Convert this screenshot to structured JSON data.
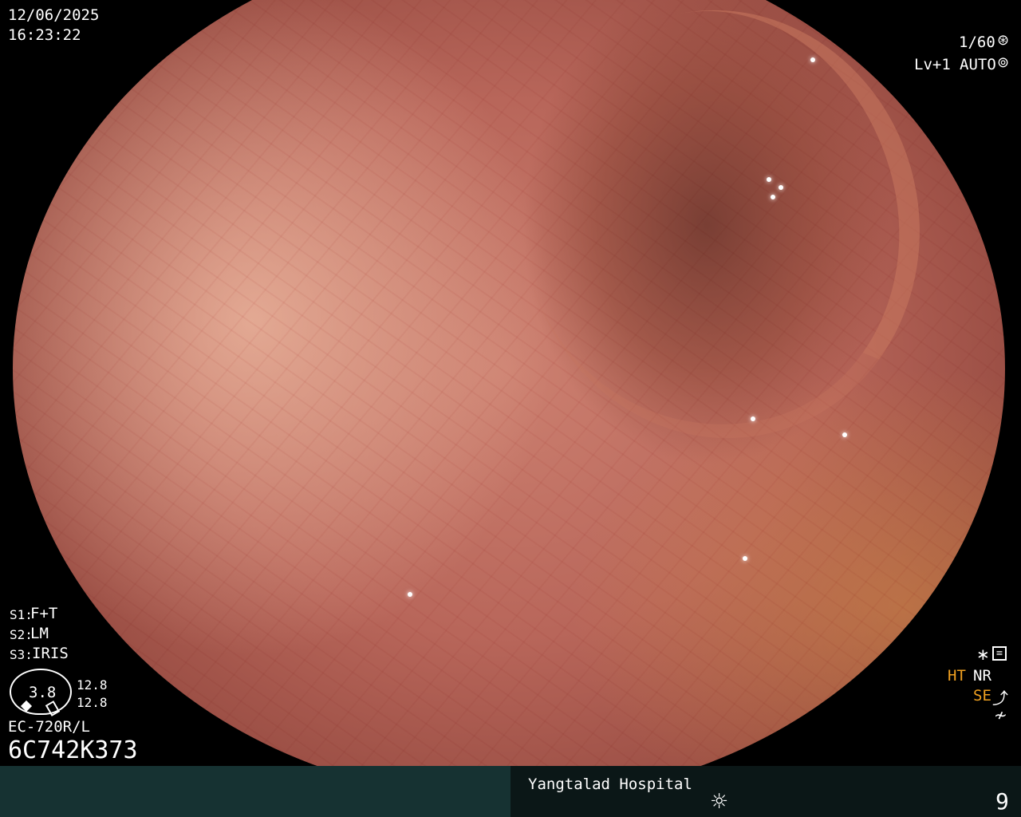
{
  "datetime": {
    "date": "12/06/2025",
    "time": "16:23:22"
  },
  "exposure": {
    "shutter": "1/60",
    "level": "Lv+1",
    "mode": "AUTO"
  },
  "settings": {
    "s1": {
      "key": "S1:",
      "value": "F+T"
    },
    "s2": {
      "key": "S2:",
      "value": "LM"
    },
    "s3": {
      "key": "S3:",
      "value": "IRIS"
    }
  },
  "gauge": {
    "value": "3.8",
    "upper": "12.8",
    "lower": "12.8"
  },
  "scope": {
    "model": "EC-720R/L",
    "serial": "6C742K373"
  },
  "modes": {
    "ht": "HT",
    "nr": "NR",
    "se": "SE"
  },
  "footer": {
    "hospital": "Yangtalad Hospital",
    "number": "9"
  },
  "icons": {
    "shutter": "aperture-icon",
    "auto": "iris-icon",
    "settings": "settings-panel-icon",
    "star": "asterisk-icon",
    "se_curve": "curve-icon",
    "freeze": "slash-icon",
    "light": "sun-icon"
  }
}
